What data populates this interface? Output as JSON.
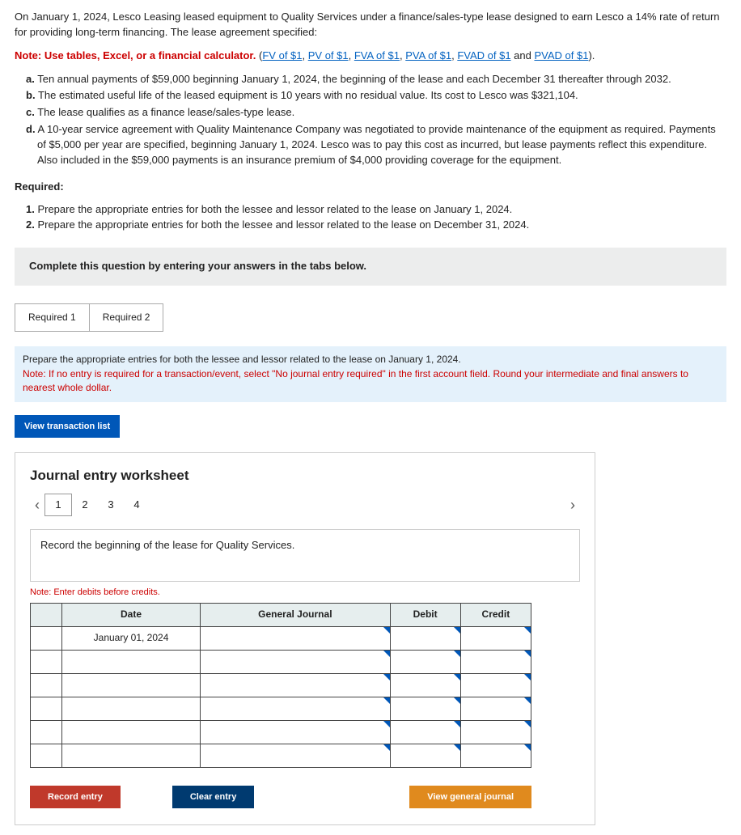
{
  "intro": "On January 1, 2024, Lesco Leasing leased equipment to Quality Services under a finance/sales-type lease designed to earn Lesco a 14% rate of return for providing long-term financing. The lease agreement specified:",
  "note_prefix": "Note: Use tables, Excel, or a financial calculator.",
  "links": {
    "open": "(",
    "fv": "FV of $1",
    "pv": "PV of $1",
    "fva": "FVA of $1",
    "pva": "PVA of $1",
    "fvad": "FVAD of $1",
    "pvad": "PVAD of $1",
    "and": " and ",
    "close": ")."
  },
  "sep": ", ",
  "items": {
    "a_lead": "a.",
    "a": " Ten annual payments of $59,000 beginning January 1, 2024, the beginning of the lease and each December 31 thereafter through 2032.",
    "b_lead": "b.",
    "b": " The estimated useful life of the leased equipment is 10 years with no residual value. Its cost to Lesco was $321,104.",
    "c_lead": "c.",
    "c": " The lease qualifies as a finance lease/sales-type lease.",
    "d_lead": "d.",
    "d": " A 10-year service agreement with Quality Maintenance Company was negotiated to provide maintenance of the equipment as required. Payments of $5,000 per year are specified, beginning January 1, 2024. Lesco was to pay this cost as incurred, but lease payments reflect this expenditure. Also included in the $59,000 payments is an insurance premium of $4,000 providing coverage for the equipment."
  },
  "required_label": "Required:",
  "req": {
    "r1_lead": "1.",
    "r1": " Prepare the appropriate entries for both the lessee and lessor related to the lease on January 1, 2024.",
    "r2_lead": "2.",
    "r2": " Prepare the appropriate entries for both the lessee and lessor related to the lease on December 31, 2024."
  },
  "instruct": "Complete this question by entering your answers in the tabs below.",
  "tabs": {
    "t1": "Required 1",
    "t2": "Required 2"
  },
  "notebox": {
    "line1": "Prepare the appropriate entries for both the lessee and lessor related to the lease on January 1, 2024.",
    "line2": "Note: If no entry is required for a transaction/event, select \"No journal entry required\" in the first account field. Round your intermediate and final answers to nearest whole dollar."
  },
  "view_list": "View transaction list",
  "ws_title": "Journal entry worksheet",
  "pages": {
    "p1": "1",
    "p2": "2",
    "p3": "3",
    "p4": "4"
  },
  "record_instruction": "Record the beginning of the lease for Quality Services.",
  "note_red": "Note: Enter debits before credits.",
  "table": {
    "h_date": "Date",
    "h_gj": "General Journal",
    "h_debit": "Debit",
    "h_credit": "Credit",
    "date0": "January 01, 2024"
  },
  "buttons": {
    "record": "Record entry",
    "clear": "Clear entry",
    "view": "View general journal"
  }
}
